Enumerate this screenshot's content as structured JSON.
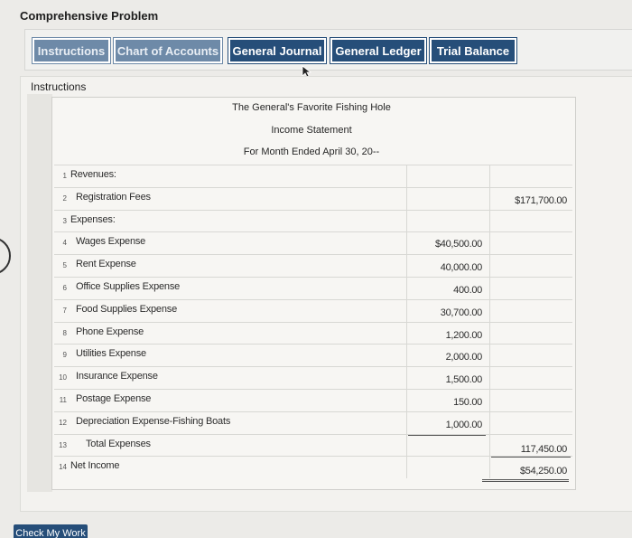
{
  "page_title": "Comprehensive Problem",
  "tabs": [
    {
      "label": "Instructions",
      "dim": true
    },
    {
      "label": "Chart of Accounts",
      "dim": true
    },
    {
      "label": "General Journal",
      "dim": false
    },
    {
      "label": "General Ledger",
      "dim": false
    },
    {
      "label": "Trial Balance",
      "dim": false
    }
  ],
  "panel_label": "Instructions",
  "statement": {
    "company": "The General's Favorite Fishing Hole",
    "title": "Income Statement",
    "period": "For Month Ended April 30, 20--"
  },
  "rows": [
    {
      "num": "1",
      "label": "Revenues:",
      "indent": 0,
      "col1": "",
      "col2": ""
    },
    {
      "num": "2",
      "label": "Registration Fees",
      "indent": 1,
      "col1": "",
      "col2": "$171,700.00"
    },
    {
      "num": "3",
      "label": "Expenses:",
      "indent": 0,
      "col1": "",
      "col2": ""
    },
    {
      "num": "4",
      "label": "Wages Expense",
      "indent": 1,
      "col1": "$40,500.00",
      "col2": ""
    },
    {
      "num": "5",
      "label": "Rent Expense",
      "indent": 1,
      "col1": "40,000.00",
      "col2": ""
    },
    {
      "num": "6",
      "label": "Office Supplies Expense",
      "indent": 1,
      "col1": "400.00",
      "col2": ""
    },
    {
      "num": "7",
      "label": "Food Supplies Expense",
      "indent": 1,
      "col1": "30,700.00",
      "col2": ""
    },
    {
      "num": "8",
      "label": "Phone Expense",
      "indent": 1,
      "col1": "1,200.00",
      "col2": ""
    },
    {
      "num": "9",
      "label": "Utilities Expense",
      "indent": 1,
      "col1": "2,000.00",
      "col2": ""
    },
    {
      "num": "10",
      "label": "Insurance Expense",
      "indent": 1,
      "col1": "1,500.00",
      "col2": ""
    },
    {
      "num": "11",
      "label": "Postage Expense",
      "indent": 1,
      "col1": "150.00",
      "col2": ""
    },
    {
      "num": "12",
      "label": "Depreciation Expense-Fishing Boats",
      "indent": 1,
      "col1": "1,000.00",
      "col2": ""
    },
    {
      "num": "13",
      "label": "Total Expenses",
      "indent": 2,
      "col1": "",
      "col2": "117,450.00"
    },
    {
      "num": "14",
      "label": "Net Income",
      "indent": 0,
      "col1": "",
      "col2": "$54,250.00"
    }
  ],
  "check_button": "Check My Work"
}
